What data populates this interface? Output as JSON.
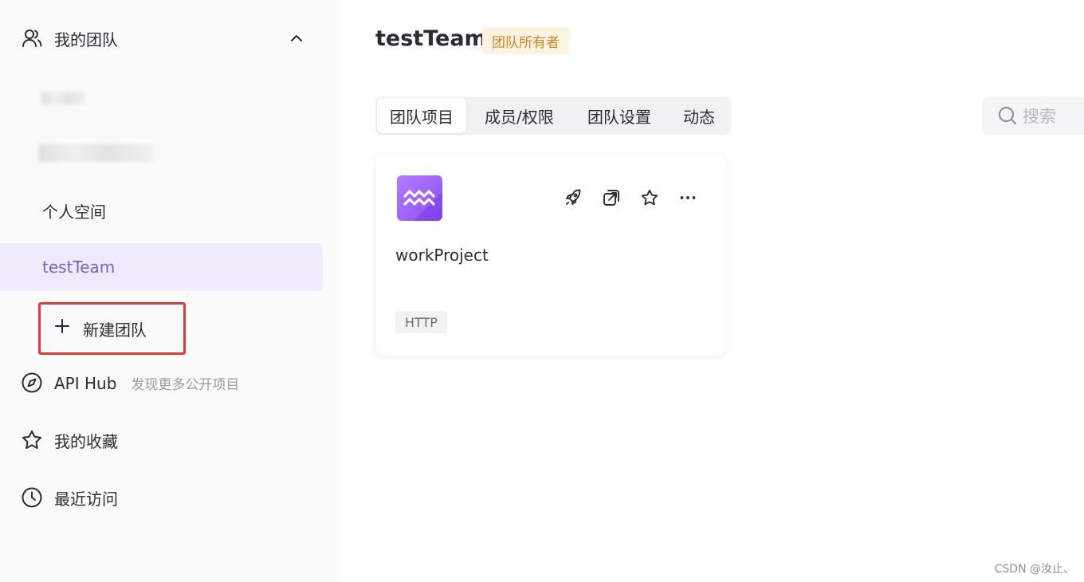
{
  "sidebar": {
    "my_teams": {
      "label": "我的团队",
      "icon": "users-icon",
      "expanded": true
    },
    "teams": [
      {
        "label": "个人空间",
        "active": false
      },
      {
        "label": "testTeam",
        "active": true
      }
    ],
    "new_team": {
      "label": "新建团队",
      "icon": "plus-icon"
    },
    "api_hub": {
      "label": "API Hub",
      "hint": "发现更多公开项目",
      "icon": "compass-icon"
    },
    "favorites": {
      "label": "我的收藏",
      "icon": "star-icon"
    },
    "recent": {
      "label": "最近访问",
      "icon": "clock-icon"
    }
  },
  "header": {
    "title": "testTeam",
    "badge": "团队所有者"
  },
  "tabs": [
    {
      "label": "团队项目",
      "active": true
    },
    {
      "label": "成员/权限",
      "active": false
    },
    {
      "label": "团队设置",
      "active": false
    },
    {
      "label": "动态",
      "active": false
    }
  ],
  "search": {
    "placeholder": "搜索",
    "icon": "search-icon"
  },
  "projects": [
    {
      "name": "workProject",
      "tag": "HTTP",
      "actions": [
        "rocket-icon",
        "external-link-icon",
        "star-icon",
        "more-icon"
      ]
    }
  ],
  "watermark": "CSDN @汝止、",
  "colors": {
    "accent": "#7a5ddb",
    "active_bg": "#efebfc",
    "badge_text": "#d6811e",
    "badge_bg": "#fdf3e1",
    "highlight_border": "#e33b35"
  }
}
